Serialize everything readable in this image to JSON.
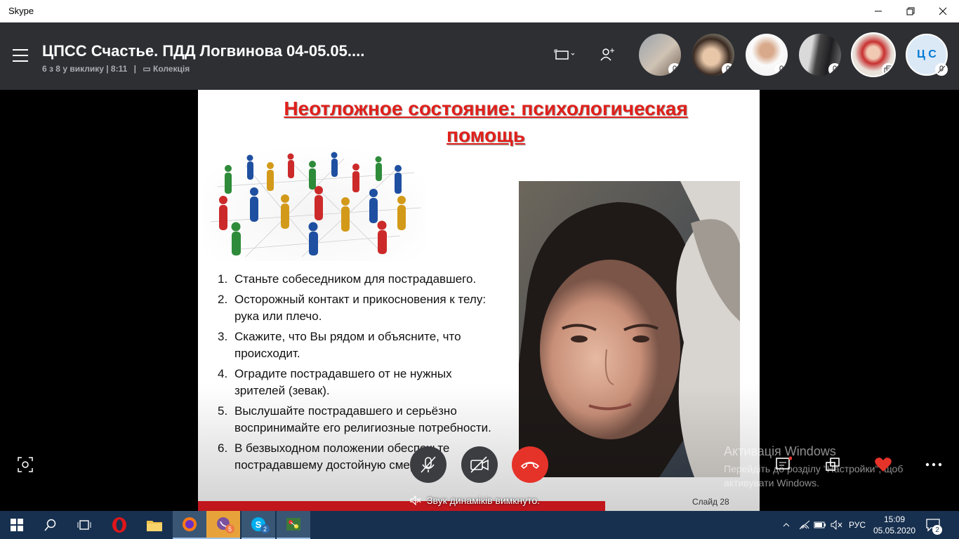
{
  "window": {
    "title": "Skype"
  },
  "call": {
    "title": "ЦПСС Счастье. ПДД Логвинова 04-05.05....",
    "participants_status": "6 з 8 у виклику | 8:11",
    "collection_label": "Колекція",
    "participants": [
      {
        "kind": "photo",
        "muted": true
      },
      {
        "kind": "photo",
        "muted": true
      },
      {
        "kind": "photo",
        "muted": true
      },
      {
        "kind": "photo",
        "muted": true
      },
      {
        "kind": "photo",
        "sharing": true
      },
      {
        "kind": "initials",
        "initials": "Ц С",
        "muted": true
      }
    ]
  },
  "slide": {
    "title_line1": "Неотложное состояние: психологическая",
    "title_line2": "помощь",
    "steps": [
      {
        "num": "1.",
        "text": "Станьте собеседником для пострадавшего."
      },
      {
        "num": "2.",
        "text": "Осторожный контакт и прикосновения к телу: рука или плечо."
      },
      {
        "num": "3.",
        "text": "Скажите, что Вы рядом и объясните, что происходит."
      },
      {
        "num": "4.",
        "text": "Оградите пострадавшего от не нужных зрителей (зевак)."
      },
      {
        "num": "5.",
        "text": "Выслушайте пострадавшего и серьёзно воспринимайте его религиозные потребности."
      },
      {
        "num": "6.",
        "text": "В безвыходном положении обеспечьте пострадавшему достойную смерть."
      }
    ],
    "slide_number": "Слайд 28"
  },
  "notifications": {
    "speaker_muted": "Звук динаміків вимкнуто."
  },
  "activation": {
    "title": "Активація Windows",
    "text": "Перейдіть до розділу \"Настройки\", щоб активувати Windows."
  },
  "taskbar": {
    "viber_badge": "5",
    "skype_badge": "2",
    "language": "РУС",
    "time": "15:09",
    "date": "05.05.2020",
    "notifications_count": "2"
  },
  "colors": {
    "header_bg": "#2d2f33",
    "accent": "#0078d4",
    "hangup": "#e6332a",
    "slide_title": "#e0201b",
    "taskbar": "#17304f"
  }
}
